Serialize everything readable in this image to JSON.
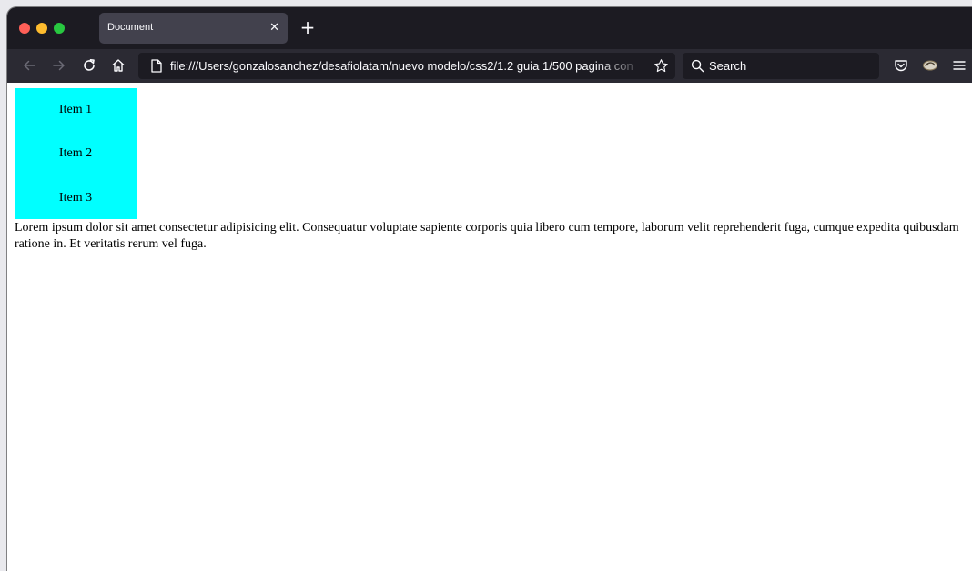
{
  "browser": {
    "traffic_lights": {
      "close_color": "#ff5f57",
      "minimize_color": "#febc2e",
      "zoom_color": "#28c840"
    },
    "tab": {
      "title": "Document",
      "close_glyph": "✕"
    },
    "new_tab_glyph": "+",
    "url": "file:///Users/gonzalosanchez/desafiolatam/nuevo modelo/css2/1.2 guia 1/500 pagina con",
    "search": {
      "placeholder": "Search"
    },
    "icons": {
      "back": "arrow-left-icon",
      "forward": "arrow-right-icon",
      "reload": "reload-icon",
      "home": "home-icon",
      "page": "page-icon",
      "bookmark": "star-icon",
      "search": "search-icon",
      "pocket": "pocket-icon",
      "extension": "extension-icon",
      "menu": "hamburger-menu-icon"
    }
  },
  "page": {
    "background": "#ffffff",
    "menu": {
      "background": "#00ffff",
      "items": [
        "Item 1",
        "Item 2",
        "Item 3"
      ]
    },
    "paragraph": "Lorem ipsum dolor sit amet consectetur adipisicing elit. Consequatur voluptate sapiente corporis quia libero cum tempore, laborum velit reprehenderit fuga, cumque expedita quibusdam ratione in. Et veritatis rerum vel fuga."
  }
}
